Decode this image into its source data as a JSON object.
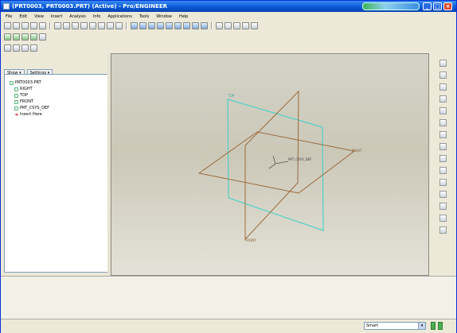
{
  "window": {
    "title": "(PRT0003, PRT0003.PRT) (Active) - Pro/ENGINEER",
    "min_glyph": "_",
    "max_glyph": "□",
    "close_glyph": "×"
  },
  "menubar": {
    "items": [
      "File",
      "Edit",
      "View",
      "Insert",
      "Analysis",
      "Info",
      "Applications",
      "Tools",
      "Window",
      "Help"
    ]
  },
  "navigator": {
    "tabs": [
      "Show ▾",
      "Settings ▾"
    ],
    "tree": [
      {
        "label": "PRT0003.PRT",
        "icon": "part-icon"
      },
      {
        "label": "RIGHT",
        "icon": "datum-plane-icon"
      },
      {
        "label": "TOP",
        "icon": "datum-plane-icon"
      },
      {
        "label": "FRONT",
        "icon": "datum-plane-icon"
      },
      {
        "label": "PRT_CSYS_DEF",
        "icon": "csys-icon"
      },
      {
        "label": "Insert Here",
        "icon": "insert-arrow-icon"
      }
    ]
  },
  "viewport": {
    "plane_labels": {
      "front": "FRONT",
      "right": "RIGHT",
      "top": "TOP"
    },
    "csys_label": "PRT_CSYS_DEF",
    "colors": {
      "datum_plane_brown": "#9b6a3b",
      "datum_plane_cyan": "#4fd0c8",
      "background_top": "#d4d3c7"
    }
  },
  "statusbar": {
    "filter_value": "Smart",
    "filter_arrow": "▾"
  }
}
